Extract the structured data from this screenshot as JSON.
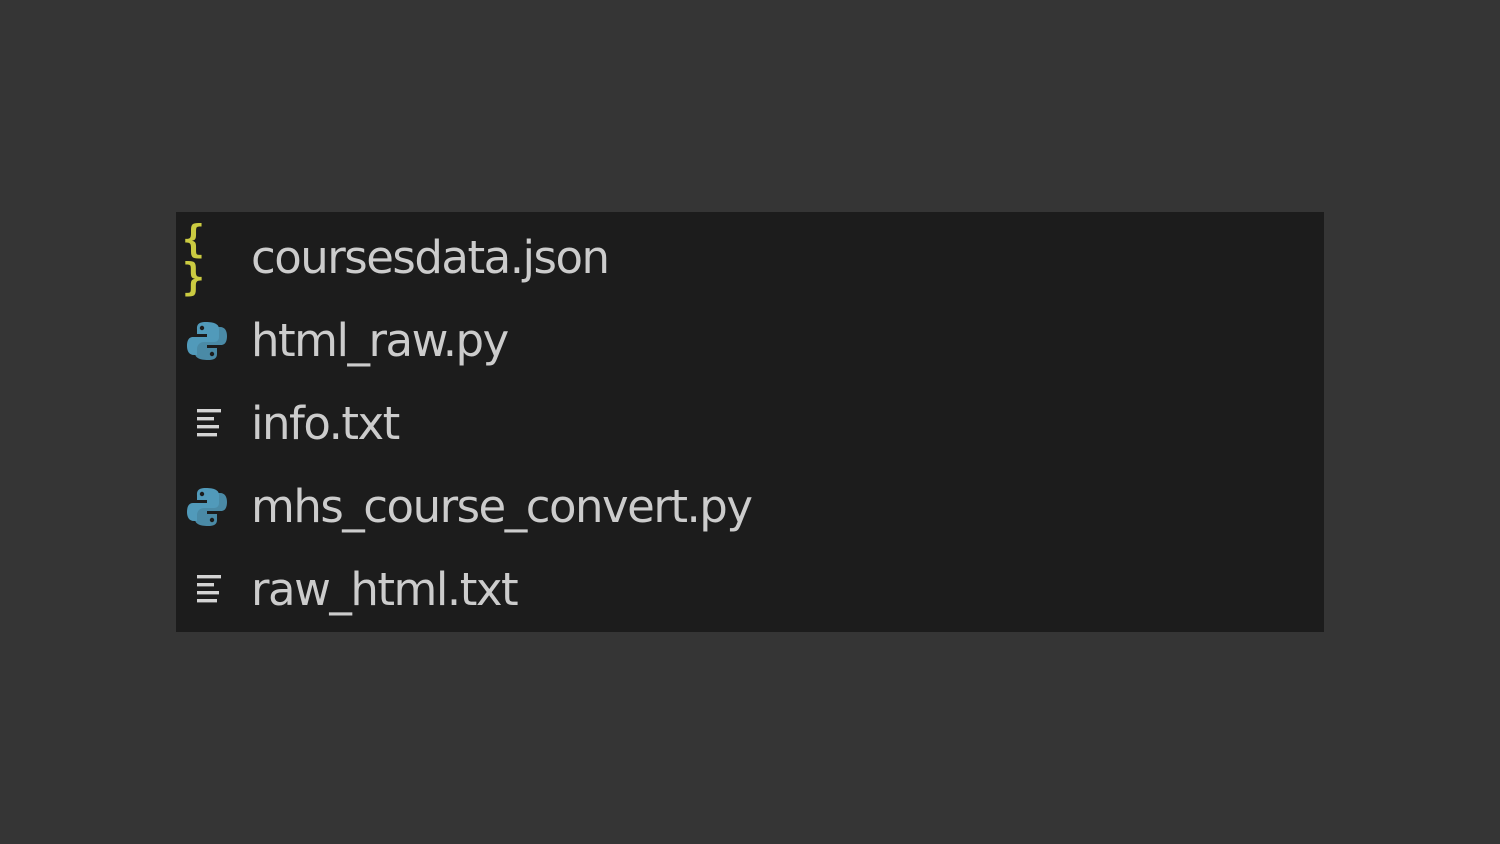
{
  "colors": {
    "page_background": "#353535",
    "panel_background": "#1c1c1c",
    "filename_text": "#cccccc",
    "json_icon": "#cbcb41",
    "python_icon": "#519aba",
    "text_icon": "#d4d4d4"
  },
  "explorer": {
    "files": [
      {
        "name": "coursesdata.json",
        "icon": "json-braces-icon"
      },
      {
        "name": "html_raw.py",
        "icon": "python-icon"
      },
      {
        "name": "info.txt",
        "icon": "text-lines-icon"
      },
      {
        "name": "mhs_course_convert.py",
        "icon": "python-icon"
      },
      {
        "name": "raw_html.txt",
        "icon": "text-lines-icon"
      }
    ],
    "json_icon_glyph": "{ }"
  }
}
